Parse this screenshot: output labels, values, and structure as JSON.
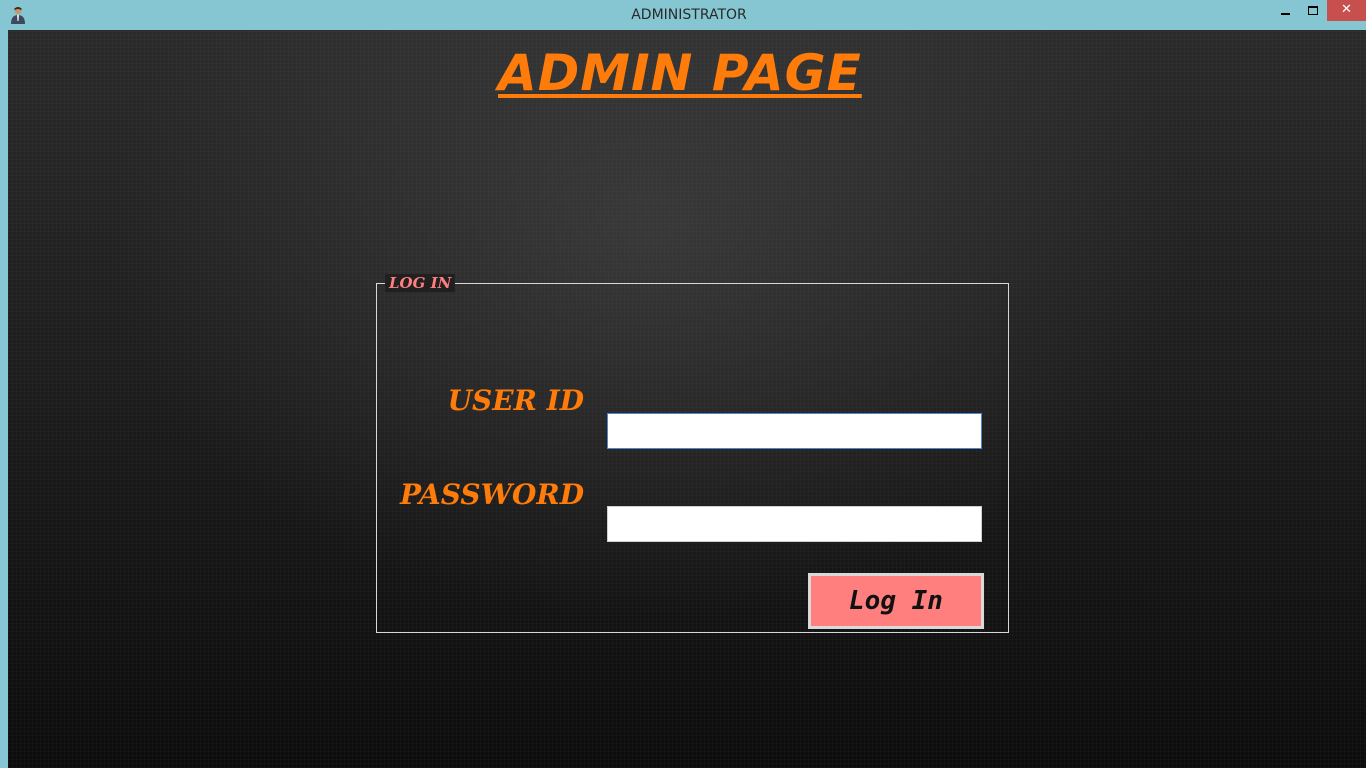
{
  "window": {
    "title": "ADMINISTRATOR",
    "app_icon": "admin-person-icon",
    "controls": {
      "minimize_icon": "minimize-icon",
      "maximize_icon": "maximize-icon",
      "close_label": "✕"
    }
  },
  "main": {
    "page_title": "ADMIN PAGE",
    "login_group": {
      "legend": "LOG IN",
      "user_id_label": "USER ID",
      "user_id_value": "",
      "password_label": "PASSWORD",
      "password_value": "",
      "login_button_label": "Log In"
    }
  },
  "colors": {
    "title_orange": "#ff7c0a",
    "legend_pink": "#ff7f7f",
    "button_fill": "#ff7f7f",
    "close_red": "#c7504f",
    "titlebar": "#86c6d2"
  }
}
